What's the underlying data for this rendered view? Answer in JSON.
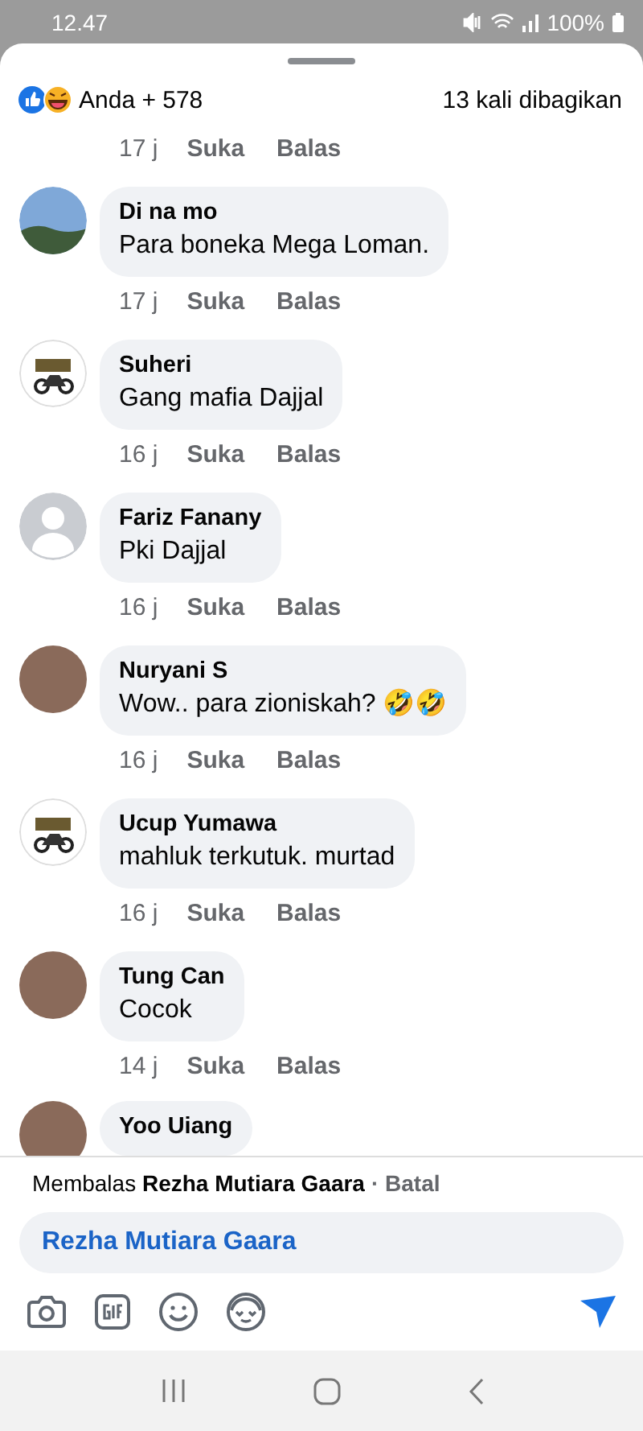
{
  "status_bar": {
    "time": "12.47",
    "battery": "100%"
  },
  "header": {
    "reactions": "Anda + 578",
    "shares": "13 kali dibagikan"
  },
  "comments": [
    {
      "kind": "tail",
      "time": "17 j",
      "like": "Suka",
      "reply": "Balas"
    },
    {
      "kind": "full",
      "avatar": {
        "kind": "sky"
      },
      "name": "Di na mo",
      "text": "Para boneka Mega Loman.",
      "time": "17 j",
      "like": "Suka",
      "reply": "Balas"
    },
    {
      "kind": "full",
      "avatar": {
        "kind": "drawing"
      },
      "name": "Suheri",
      "text": "Gang mafia Dajjal",
      "time": "16 j",
      "like": "Suka",
      "reply": "Balas"
    },
    {
      "kind": "full",
      "avatar": {
        "kind": "default"
      },
      "name": "Fariz Fanany",
      "text": "Pki Dajjal",
      "time": "16 j",
      "like": "Suka",
      "reply": "Balas"
    },
    {
      "kind": "full",
      "avatar": {
        "kind": "photo"
      },
      "name": "Nuryani S",
      "text": "Wow.. para zioniskah? 🤣🤣",
      "time": "16 j",
      "like": "Suka",
      "reply": "Balas"
    },
    {
      "kind": "full",
      "avatar": {
        "kind": "drawing"
      },
      "name": "Ucup Yumawa",
      "text": "mahluk terkutuk. murtad",
      "time": "16 j",
      "like": "Suka",
      "reply": "Balas"
    },
    {
      "kind": "full",
      "avatar": {
        "kind": "photo"
      },
      "name": "Tung Can",
      "text": "Cocok",
      "time": "14 j",
      "like": "Suka",
      "reply": "Balas"
    },
    {
      "kind": "peek",
      "avatar": {
        "kind": "photo"
      },
      "name": "Yoo Uiang"
    }
  ],
  "reply_bar": {
    "prefix": "Membalas",
    "target": "Rezha Mutiara Gaara",
    "cancel": "· Batal",
    "value": "Rezha Mutiara Gaara"
  }
}
